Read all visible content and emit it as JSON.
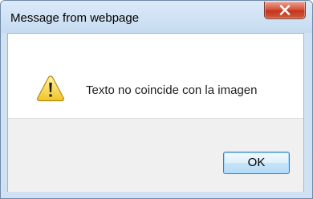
{
  "window": {
    "title": "Message from webpage"
  },
  "dialog": {
    "icon": "warning-icon",
    "message": "Texto no coincide con la imagen",
    "ok_label": "OK"
  },
  "colors": {
    "titlebar": "#c6dbf1",
    "close_button": "#c2351f",
    "ok_button_border": "#3c7fb1",
    "footer": "#f0f0f0"
  }
}
